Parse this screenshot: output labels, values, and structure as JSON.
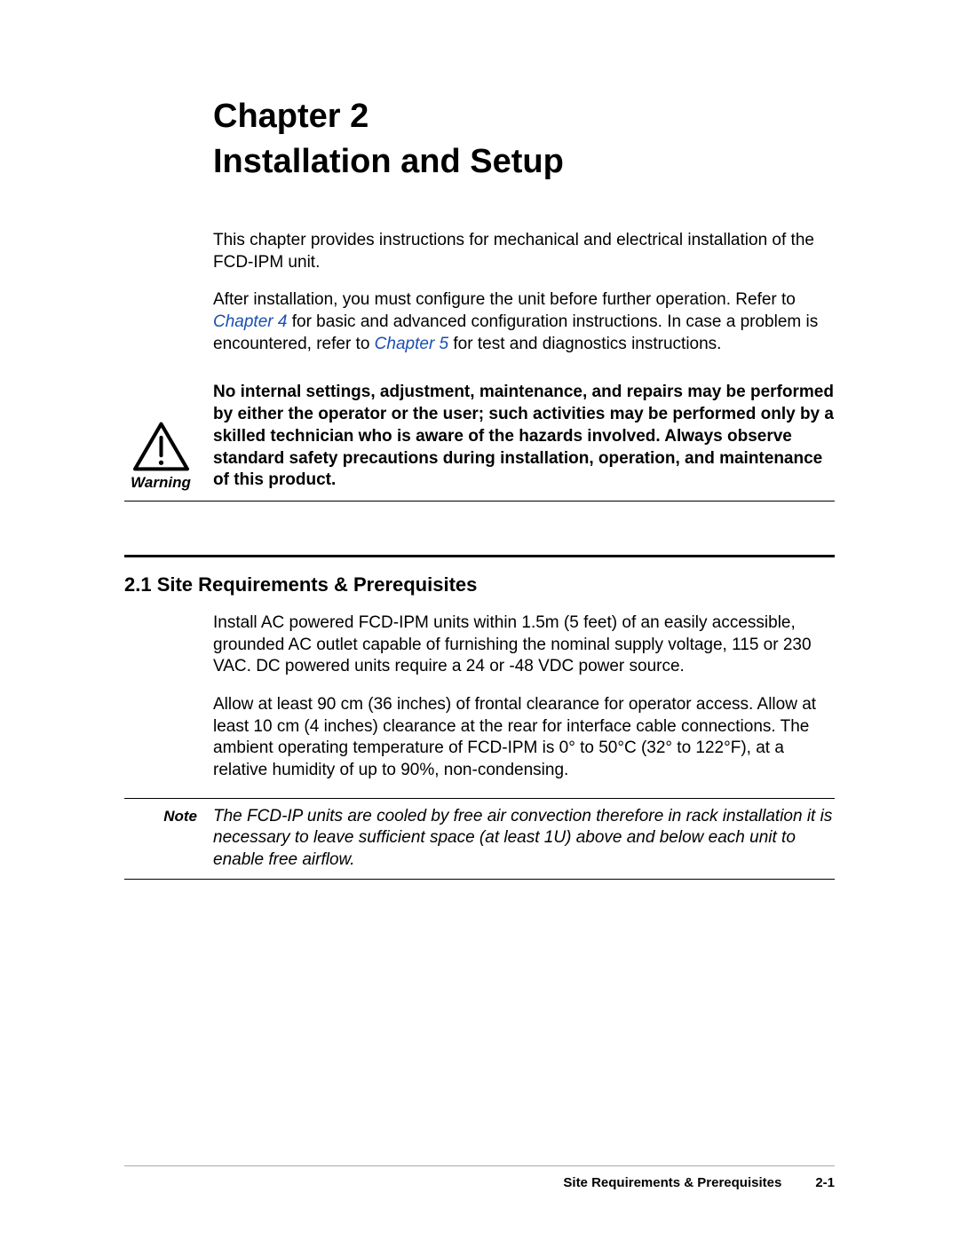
{
  "chapter": {
    "number": "Chapter 2",
    "title": "Installation and Setup"
  },
  "intro": {
    "p1": "This chapter provides instructions for mechanical and electrical installation of the FCD-IPM unit.",
    "p2_a": "After installation, you must configure the unit before further operation. Refer to ",
    "p2_link1": "Chapter 4",
    "p2_b": " for basic and advanced configuration instructions. In case a problem is encountered, refer to ",
    "p2_link2": "Chapter 5",
    "p2_c": " for test and diagnostics instructions."
  },
  "warning": {
    "label": "Warning",
    "text": "No internal settings, adjustment, maintenance, and repairs may be performed by either the operator or the user; such activities may be performed only by a skilled technician who is aware of the hazards involved. Always observe standard safety precautions during installation, operation, and maintenance of this product."
  },
  "section": {
    "heading": "2.1  Site Requirements & Prerequisites",
    "p1": "Install AC powered FCD-IPM units within 1.5m (5 feet) of an easily accessible, grounded AC outlet capable of furnishing the nominal supply voltage, 115 or 230 VAC. DC powered units require a 24 or -48 VDC power source.",
    "p2": "Allow at least 90 cm (36 inches) of frontal clearance for operator access. Allow at least 10 cm (4 inches) clearance at the rear for interface cable connections. The ambient operating temperature of FCD-IPM is 0° to 50°C (32° to 122°F), at a relative humidity of up to 90%, non-condensing."
  },
  "note": {
    "label": "Note",
    "text": "The FCD-IP units are cooled by free air convection therefore in rack installation it is necessary to leave sufficient space (at least 1U) above and below each unit to enable free airflow."
  },
  "footer": {
    "title": "Site Requirements & Prerequisites",
    "page": "2-1"
  }
}
